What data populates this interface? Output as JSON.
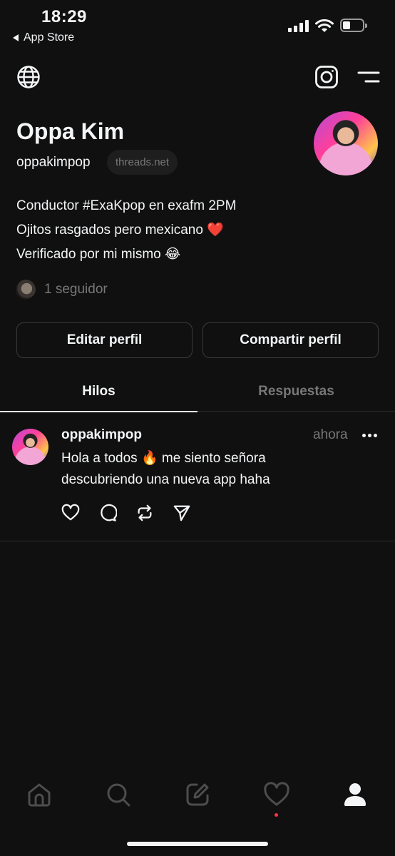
{
  "status_bar": {
    "time": "18:29",
    "back_label": "App Store",
    "battery_percent": 40
  },
  "header": {
    "left_icon": "globe-icon",
    "right_icons": [
      "instagram-icon",
      "menu-icon"
    ]
  },
  "profile": {
    "name": "Oppa Kim",
    "handle": "oppakimpop",
    "domain": "threads.net",
    "bio_lines": [
      {
        "text": "Conductor #ExaKpop en exafm 2PM",
        "emoji": ""
      },
      {
        "text": "Ojitos rasgados pero mexicano",
        "emoji": "❤️"
      },
      {
        "text": "Verificado por mi mismo",
        "emoji": "😂"
      }
    ],
    "followers_text": "1 seguidor"
  },
  "buttons": {
    "edit_label": "Editar perfil",
    "share_label": "Compartir perfil"
  },
  "tabs": [
    {
      "label": "Hilos",
      "active": true
    },
    {
      "label": "Respuestas",
      "active": false
    }
  ],
  "post": {
    "username": "oppakimpop",
    "time": "ahora",
    "text_line1": "Hola a todos 🔥 me siento señora",
    "text_line2": "descubriendo una nueva app haha",
    "actions": [
      "heart-icon",
      "comment-icon",
      "repost-icon",
      "send-icon"
    ]
  },
  "bottom_nav": {
    "items": [
      "home-icon",
      "search-icon",
      "compose-icon",
      "activity-icon",
      "profile-icon"
    ],
    "active": "profile-icon",
    "notification_color": "#ff3040"
  },
  "colors": {
    "background": "#101010",
    "text": "#f3f5f7",
    "muted": "#777777",
    "border": "#3a3a3a"
  }
}
